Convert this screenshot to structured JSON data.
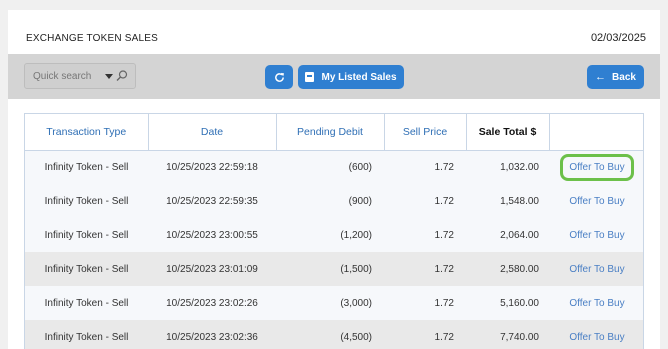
{
  "header": {
    "title": "EXCHANGE TOKEN SALES",
    "date": "02/03/2025"
  },
  "toolbar": {
    "search_placeholder": "Quick search",
    "my_listed_sales_label": "My Listed Sales",
    "back_label": "Back"
  },
  "table": {
    "columns": [
      "Transaction Type",
      "Date",
      "Pending Debit",
      "Sell Price",
      "Sale Total $",
      ""
    ],
    "rows": [
      {
        "type": "Infinity Token - Sell",
        "date": "10/25/2023 22:59:18",
        "pending_debit": "(600)",
        "sell_price": "1.72",
        "sale_total": "1,032.00",
        "action": "Offer To Buy"
      },
      {
        "type": "Infinity Token - Sell",
        "date": "10/25/2023 22:59:35",
        "pending_debit": "(900)",
        "sell_price": "1.72",
        "sale_total": "1,548.00",
        "action": "Offer To Buy"
      },
      {
        "type": "Infinity Token - Sell",
        "date": "10/25/2023 23:00:55",
        "pending_debit": "(1,200)",
        "sell_price": "1.72",
        "sale_total": "2,064.00",
        "action": "Offer To Buy"
      },
      {
        "type": "Infinity Token - Sell",
        "date": "10/25/2023 23:01:09",
        "pending_debit": "(1,500)",
        "sell_price": "1.72",
        "sale_total": "2,580.00",
        "action": "Offer To Buy"
      },
      {
        "type": "Infinity Token - Sell",
        "date": "10/25/2023 23:02:26",
        "pending_debit": "(3,000)",
        "sell_price": "1.72",
        "sale_total": "5,160.00",
        "action": "Offer To Buy"
      },
      {
        "type": "Infinity Token - Sell",
        "date": "10/25/2023 23:02:36",
        "pending_debit": "(4,500)",
        "sell_price": "1.72",
        "sale_total": "7,740.00",
        "action": "Offer To Buy"
      }
    ]
  },
  "colors": {
    "accent": "#2f7fd1",
    "link": "#4a7fc4",
    "highlight": "#6cc04a"
  },
  "icons": {
    "refresh": "refresh-icon",
    "sales": "document-icon",
    "back": "arrow-left-icon",
    "search": "search-icon",
    "dropdown": "caret-down-icon"
  }
}
